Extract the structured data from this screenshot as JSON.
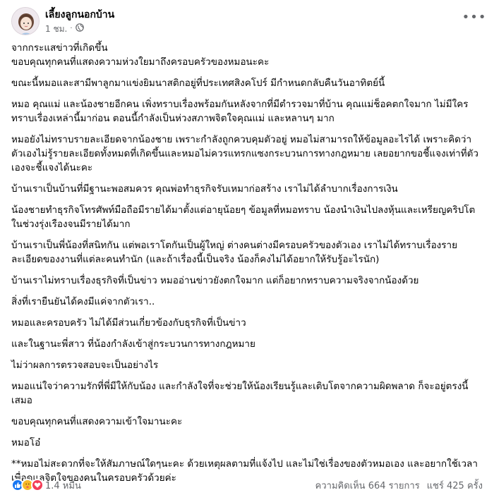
{
  "post": {
    "author": "เลี้ยงลูกนอกบ้าน",
    "time": "1 ชม.",
    "time_separator": "·",
    "privacy_icon": "globe-icon",
    "more_icon": "more-options-icon",
    "paragraphs": [
      "จากกระแสข่าวที่เกิดขึ้น\nขอบคุณทุกคนที่แสดงความห่วงใยมาถึงครอบครัวของหมอนะคะ",
      "ขณะนี้หมอและสามีพาลูกมาแข่งยิมนาสติกอยู่ที่ประเทศสิงคโปร์ มีกำหนดกลับคืนวันอาทิตย์นี้",
      "หมอ คุณแม่ และน้องชายอีกคน เพิ่งทราบเรื่องพร้อมกันหลังจากที่มีตำรวจมาที่บ้าน คุณแม่ช็อคตกใจมาก ไม่มีใครทราบเรื่องเหล่านี้มาก่อน ตอนนี้กำลังเป็นห่วงสภาพจิตใจคุณแม่ และหลานๆ มาก",
      "หมอยังไม่ทราบรายละเอียดจากน้องชาย เพราะกำลังถูกควบคุมตัวอยู่ หมอไม่สามารถให้ข้อมูลอะไรได้ เพราะคิดว่าตัวเองไม่รู้รายละเอียดทั้งหมดที่เกิดขึ้นและหมอไม่ควรแทรกแซงกระบวนการทางกฎหมาย เลยอยากขอชี้แจงเท่าที่ตัวเองจะชี้แจงได้นะคะ",
      "บ้านเราเป็นบ้านที่มีฐานะพอสมควร คุณพ่อทำธุรกิจรับเหมาก่อสร้าง เราไม่ได้ลำบากเรื่องการเงิน",
      "น้องชายทำธุรกิจโทรศัพท์มือถือมีรายได้มาตั้งแต่อายุน้อยๆ ข้อมูลที่หมอทราบ น้องนำเงินไปลงหุ้นและเหรียญคริปโต ในช่วงรุ่งเรืองจนมีรายได้มาก",
      "บ้านเราเป็นพี่น้องที่สนิทกัน แต่พอเราโตกันเป็นผู้ใหญ่ ต่างคนต่างมีครอบครัวของตัวเอง เราไม่ได้ทราบเรื่องรายละเอียดของงานที่แต่ละคนทำนัก (และถ้าเรื่องนี้เป็นจริง น้องก็คงไม่ได้อยากให้รับรู้อะไรนัก)",
      "บ้านเราไม่ทราบเรื่องธุรกิจที่เป็นข่าว หมออ่านข่าวยังตกใจมาก แต่ก็อยากทราบความจริงจากน้องด้วย",
      "สิ่งที่เรายืนยันได้คงมีแค่จากตัวเรา..",
      "หมอและครอบครัว ไม่ได้มีส่วนเกี่ยวข้องกับธุรกิจที่เป็นข่าว",
      "และในฐานะพี่สาว ที่น้องกำลังเข้าสู่กระบวนการทางกฎหมาย",
      "ไม่ว่าผลการตรวจสอบจะเป็นอย่างไร",
      "หมอแน่ใจว่าความรักที่พี่มีให้กับน้อง และกำลังใจที่จะช่วยให้น้องเรียนรู้และเติบโตจากความผิดพลาด ก็จะอยู่ตรงนี้เสมอ",
      "ขอบคุณทุกคนที่แสดงความเข้าใจมานะคะ",
      "หมอโอ๋",
      "**หมอไม่สะดวกที่จะให้สัมภาษณ์ใดๆนะคะ ด้วยเหตุผลตามที่แจ้งไป และไม่ใช่เรื่องของตัวหมอเอง และอยากใช้เวลาเพื่อดูแลจิตใจของคนในครอบครัวด้วยค่ะ"
    ],
    "reactions": {
      "icons": [
        "like-icon",
        "care-icon",
        "love-icon"
      ],
      "count": "1.4 หมื่น"
    },
    "comments": "ความคิดเห็น 664 รายการ",
    "shares": "แชร์ 425 ครั้ง",
    "colors": {
      "like": "#1877f2",
      "care": "#f7b928",
      "love": "#f33e58",
      "secondary_text": "#65676b"
    }
  }
}
